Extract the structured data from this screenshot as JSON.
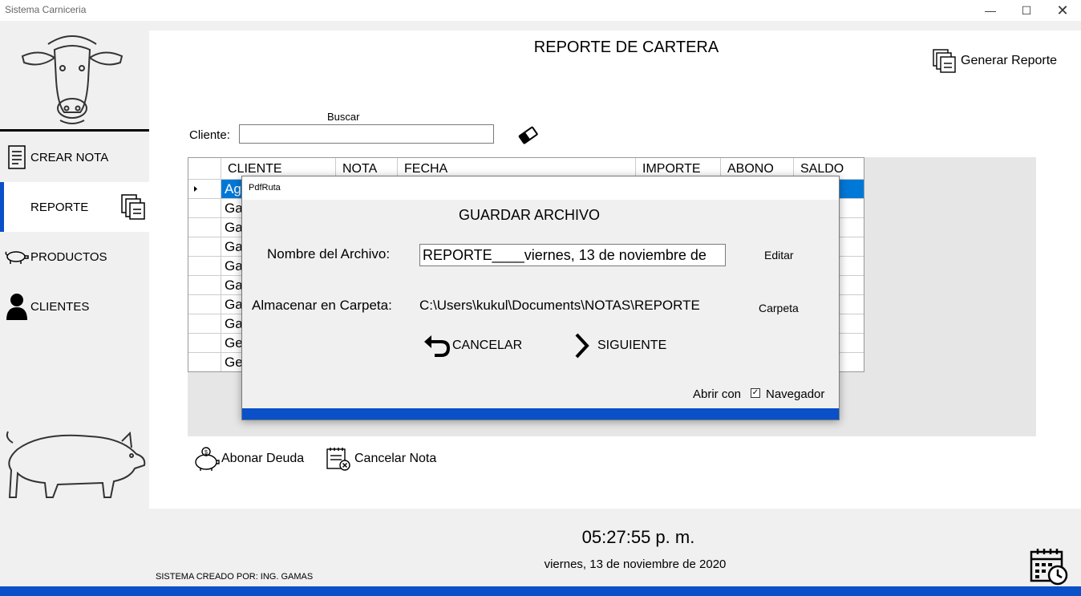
{
  "window": {
    "title": "Sistema Carniceria"
  },
  "sidebar": {
    "items": [
      {
        "label": "CREAR NOTA",
        "icon": "document-icon"
      },
      {
        "label": "REPORTE",
        "icon": "report-icon"
      },
      {
        "label": "PRODUCTOS",
        "icon": "pig-icon"
      },
      {
        "label": "CLIENTES",
        "icon": "user-icon"
      }
    ]
  },
  "main": {
    "title": "REPORTE DE CARTERA",
    "generate_label": "Generar Reporte",
    "search_label": "Buscar",
    "client_label": "Cliente:",
    "search_value": ""
  },
  "table": {
    "columns": [
      "CLIENTE",
      "NOTA",
      "FECHA",
      "IMPORTE",
      "ABONO",
      "SALDO"
    ],
    "rows": [
      "Ag",
      "Ga",
      "Ga",
      "Ga",
      "Ga",
      "Ga",
      "Ga",
      "Ga",
      "Ge",
      "Ge"
    ]
  },
  "actions": {
    "abonar": "Abonar Deuda",
    "cancelar_nota": "Cancelar Nota"
  },
  "footer": {
    "time": "05:27:55 p. m.",
    "date": "viernes, 13 de noviembre de 2020",
    "credit": "SISTEMA CREADO POR: ING. GAMAS"
  },
  "dialog": {
    "title": "PdfRuta",
    "heading": "GUARDAR ARCHIVO",
    "file_label": "Nombre del Archivo:",
    "file_value": "REPORTE____viernes, 13 de noviembre de",
    "edit_link": "Editar",
    "folder_label": "Almacenar en Carpeta:",
    "folder_value": "C:\\Users\\kukul\\Documents\\NOTAS\\REPORTE",
    "folder_link": "Carpeta",
    "cancel_label": "CANCELAR",
    "next_label": "SIGUIENTE",
    "open_with_label": "Abrir con",
    "browser_label": "Navegador",
    "browser_checked": true
  },
  "colors": {
    "accent": "#0a50c8",
    "selection": "#0078d7"
  }
}
